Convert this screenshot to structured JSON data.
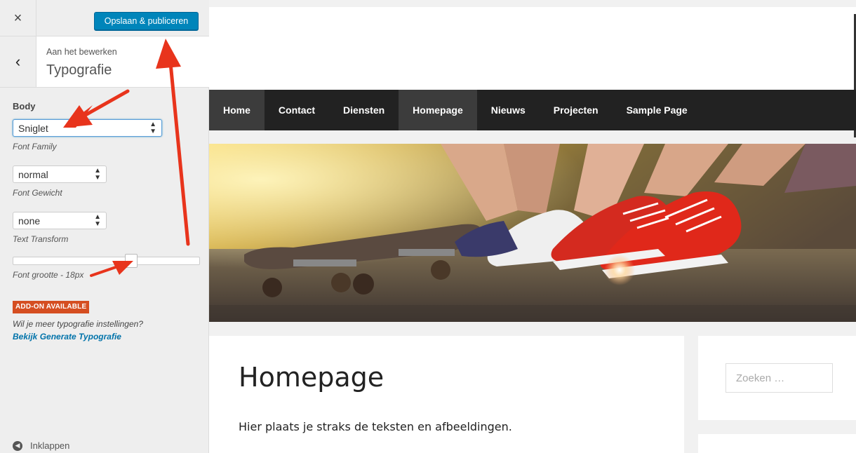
{
  "customizer": {
    "publish_label": "Opslaan & publiceren",
    "close_icon": "×",
    "back_icon": "‹",
    "editing_label": "Aan het bewerken",
    "section_title": "Typografie",
    "group_label": "Body",
    "font_family": {
      "value": "Sniglet",
      "description": "Font Family"
    },
    "font_weight": {
      "value": "normal",
      "description": "Font Gewicht"
    },
    "text_transform": {
      "value": "none",
      "description": "Text Transform"
    },
    "font_size": {
      "description": "Font grootte - 18px"
    },
    "addon": {
      "badge": "ADD-ON AVAILABLE",
      "question": "Wil je meer typografie instellingen?",
      "link": "Bekijk Generate Typografie",
      "link_suffix": "."
    },
    "collapse_label": "Inklappen",
    "colors": {
      "primary": "#0085ba",
      "addon_badge": "#d54e21",
      "annotation_arrow": "#e8341c"
    }
  },
  "site": {
    "nav": [
      "Home",
      "Contact",
      "Diensten",
      "Homepage",
      "Nieuws",
      "Projecten",
      "Sample Page"
    ],
    "current_nav": "Homepage",
    "page_title": "Homepage",
    "page_text": "Hier plaats je straks de teksten en afbeeldingen.",
    "search_placeholder": "Zoeken …",
    "colors": {
      "nav_bg": "#222222",
      "nav_current": "#3c3c3c"
    }
  }
}
